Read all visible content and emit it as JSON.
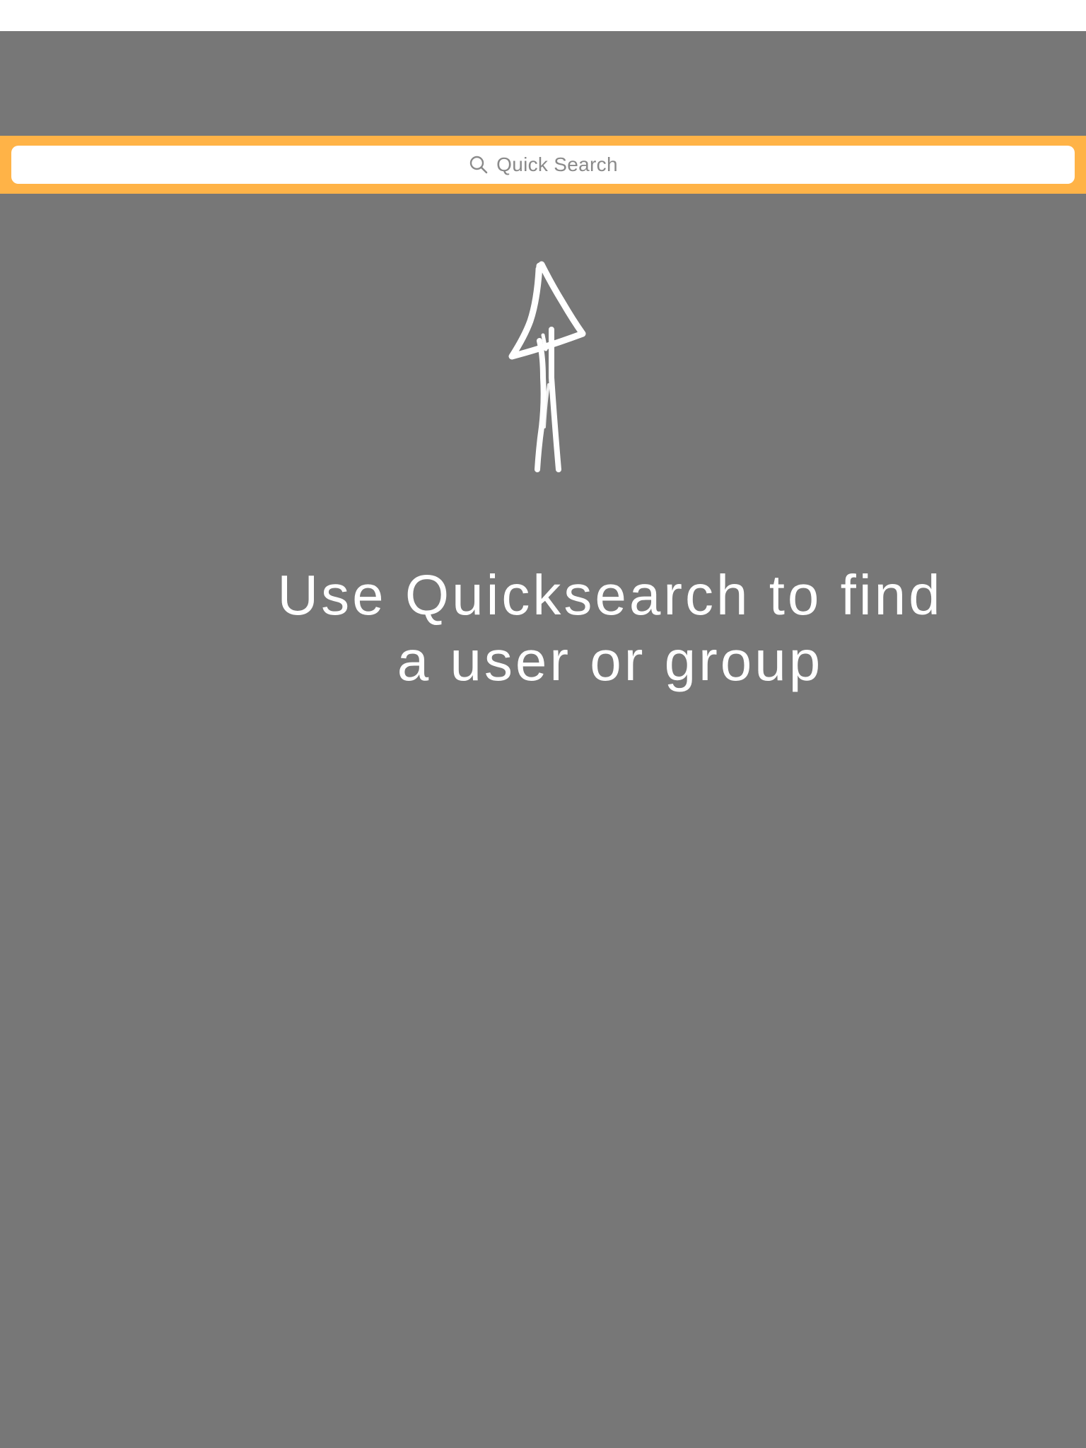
{
  "search": {
    "placeholder": "Quick Search",
    "icon": "search-icon"
  },
  "empty_state": {
    "illustration": "hand-drawn-up-arrow-icon",
    "message_line1": "Use Quicksearch to find",
    "message_line2": "a user or group"
  },
  "colors": {
    "status_bar": "#ffffff",
    "background": "#777777",
    "search_bar_accent": "#ffb347",
    "search_field": "#ffffff",
    "placeholder_text": "#8a8a8a",
    "message_text": "#ffffff"
  }
}
